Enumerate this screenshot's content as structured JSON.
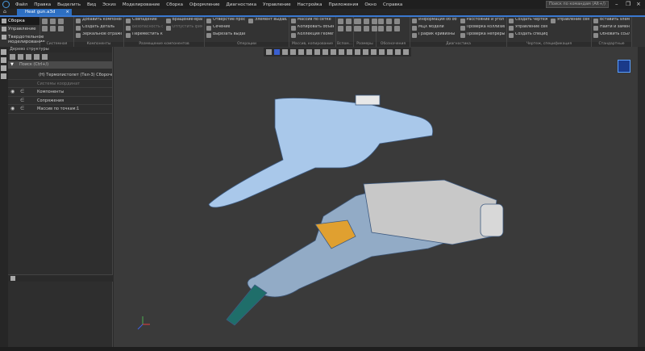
{
  "menu": [
    "Файл",
    "Правка",
    "Выделить",
    "Вид",
    "Эскиз",
    "Моделирование",
    "Сборка",
    "Оформление",
    "Диагностика",
    "Управление",
    "Настройка",
    "Приложения",
    "Окно",
    "Справка"
  ],
  "search_placeholder": "Поиск по командам (Alt+/)",
  "document_tab": "Heat gun.a3d",
  "modes": [
    "Сборка",
    "Управление",
    "Твердотельное моделирование"
  ],
  "groups": [
    {
      "label": "Системная",
      "buttons": []
    },
    {
      "label": "Компоненты",
      "buttons": [
        "Добавить компонент из...",
        "Создать деталь",
        "Зеркальное отражение из..."
      ]
    },
    {
      "label": "Размещение компонентов",
      "buttons": [
        "Совпадение",
        "Безопасность фиксации",
        "Переместить компонент",
        "Вращение-вращение",
        "Отпустить фиксацию"
      ]
    },
    {
      "label": "Операции",
      "buttons": [
        "Отверстие простое",
        "Сечение",
        "Вырезать выдавливанием",
        "Элемент выдавливания"
      ]
    },
    {
      "label": "Массив, копирование",
      "buttons": [
        "Массив по сетке",
        "Копировать объекты",
        "Коллекция геометрии"
      ]
    },
    {
      "label": "Вспом...",
      "buttons": []
    },
    {
      "label": "Размеры",
      "buttons": []
    },
    {
      "label": "Обозначения",
      "buttons": []
    },
    {
      "label": "Диагностика",
      "buttons": [
        "Информация об объекте",
        "МЦХ модели",
        "График кривизны",
        "Расстояние и угол",
        "Проверка коллизий",
        "Проверка непрерывности"
      ]
    },
    {
      "label": "Чертеж, спецификация",
      "buttons": [
        "Создать чертеж по модели",
        "Управление связанными ч...",
        "Создать спецификацию...",
        "Управление связанными с..."
      ]
    },
    {
      "label": "Стандартные изделия",
      "buttons": [
        "Вставить элемент",
        "Найти и заменить",
        "Обновить ссылки на МОД..."
      ]
    }
  ],
  "tree": {
    "title": "Дерево структуры",
    "search": "Поиск (Ctrl+/)",
    "items": [
      {
        "label": "(Н) Термопистолет (Тел-3) Сборочная е",
        "dim": false,
        "eye": false
      },
      {
        "label": "Системы координат",
        "dim": true,
        "eye": false
      },
      {
        "label": "Компоненты",
        "dim": false,
        "eye": true
      },
      {
        "label": "Сопряжения",
        "dim": false,
        "eye": false
      },
      {
        "label": "Массив по точкам:1",
        "dim": false,
        "eye": true
      }
    ]
  },
  "colors": {
    "accent": "#3a78d0",
    "body": "#a9c8ea",
    "nozzle": "#c8c8c8",
    "handle": "#1f6e6a",
    "switch": "#e0a030"
  }
}
